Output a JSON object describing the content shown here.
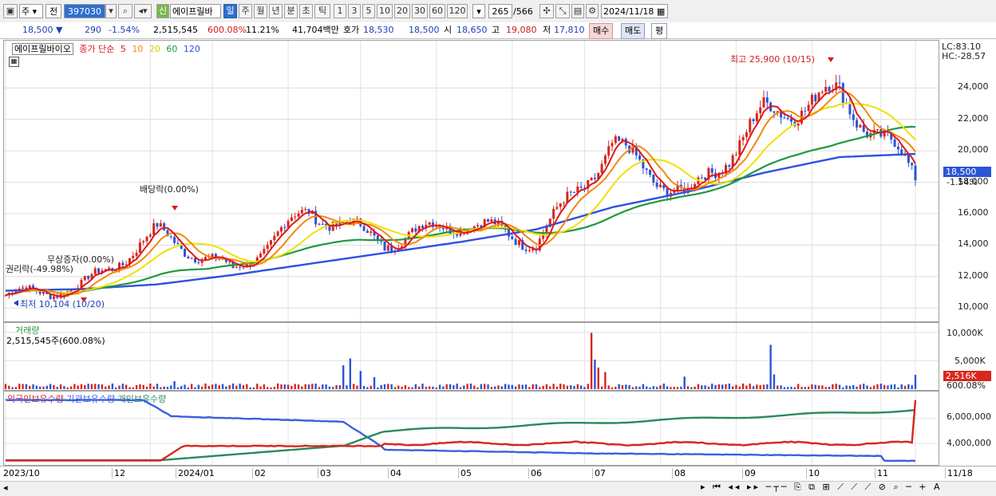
{
  "toolbar": {
    "period_code": "주",
    "market": "전",
    "stock_code": "397030",
    "stock_name_tag": "신",
    "stock_name": "에이프릴바",
    "timeframes": [
      "일",
      "주",
      "월",
      "년",
      "분",
      "초",
      "틱"
    ],
    "active_timeframe": "일",
    "minutes": [
      "1",
      "3",
      "5",
      "10",
      "20",
      "30",
      "60",
      "120"
    ],
    "count": "265",
    "total": "/566",
    "date": "2024/11/18"
  },
  "quote": {
    "price": "18,500",
    "arrow": "▼",
    "change": "290",
    "change_pct": "-1.54%",
    "volume": "2,515,545",
    "volume_ratio": "600.08%",
    "turnover": "11.21%",
    "amount": "41,704백만",
    "ask_label": "호가",
    "ask": "18,530",
    "bid": "18,500",
    "open_label": "시",
    "open": "18,650",
    "high_label": "고",
    "high": "19,080",
    "low_label": "저",
    "low": "17,810",
    "buy_label": "매수",
    "sell_label": "매도",
    "eval_label": "평"
  },
  "price_panel": {
    "title": "에이프릴바이오",
    "ma_label": "종가 단순",
    "ma_periods": [
      "5",
      "10",
      "20",
      "60",
      "120"
    ],
    "lc": "LC:83.10",
    "hc": "HC:-28.57",
    "current_price": "18,500",
    "current_pct": "-1.54%",
    "y_ticks": [
      "24,000",
      "22,000",
      "20,000",
      "18,000",
      "16,000",
      "14,000",
      "12,000",
      "10,000"
    ],
    "ann_high": "최고 25,900 (10/15)",
    "ann_low": "최저 10,104 (10/20)",
    "ann_div": "배당락(0.00%)",
    "ann_bonus": "무상증자(0.00%)",
    "ann_split": "권리락(-49.98%)"
  },
  "volume_panel": {
    "title": "거래량",
    "value": "2,515,545주(600.08%)",
    "y_ticks": [
      "10,000K",
      "5,000K"
    ],
    "current": "2,516K",
    "current_pct": "600.08%"
  },
  "holdings_panel": {
    "legend": [
      "외국인보유수량",
      "기관보유수량",
      "개인보유수량"
    ],
    "y_ticks": [
      "6,000,000",
      "4,000,000"
    ]
  },
  "x_axis": [
    "2023/10",
    "12",
    "2024/01",
    "02",
    "03",
    "04",
    "05",
    "06",
    "07",
    "08",
    "09",
    "10",
    "11",
    "11/18"
  ],
  "colors": {
    "ma5": "#e01818",
    "ma10": "#f08a10",
    "ma20": "#f0e000",
    "ma60": "#1e9a3c",
    "ma120": "#3050e0",
    "up": "#d8261e",
    "down": "#2a55d8",
    "foreign": "#d8261e",
    "institution": "#3a60e0",
    "individual": "#2a8a5a"
  },
  "chart_data": {
    "type": "line",
    "title": "에이프릴바이오",
    "x": [
      "2023/10",
      "12",
      "2024/01",
      "02",
      "03",
      "04",
      "05",
      "06",
      "07",
      "08",
      "09",
      "10",
      "11"
    ],
    "series": [
      {
        "name": "종가",
        "values": [
          10800,
          11300,
          14800,
          12300,
          16200,
          14200,
          15500,
          14200,
          20300,
          17000,
          22300,
          23600,
          18500
        ]
      },
      {
        "name": "120",
        "values": [
          11100,
          11200,
          11500,
          12100,
          12800,
          13500,
          14200,
          15000,
          16400,
          17400,
          18600,
          19600,
          19800
        ]
      }
    ],
    "ylim": [
      9500,
      26500
    ],
    "volume_units": "K"
  }
}
